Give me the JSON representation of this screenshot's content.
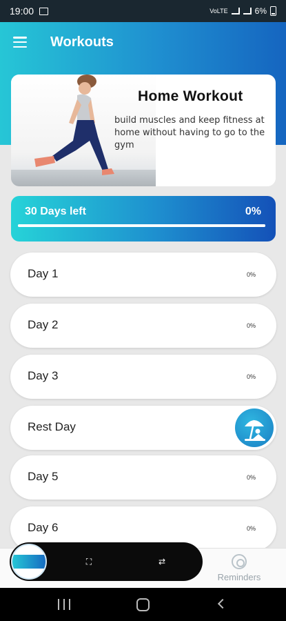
{
  "status_bar": {
    "time": "19:00",
    "battery": "6%",
    "network": "VoLTE"
  },
  "app_bar": {
    "title": "Workouts",
    "menu_icon": "hamburger-menu-icon"
  },
  "hero": {
    "title": "Home Workout",
    "description": "build muscles and keep fitness at home without having to go to the gym"
  },
  "progress": {
    "label": "30 Days left",
    "percent_label": "0%",
    "fraction": 0.0
  },
  "days": [
    {
      "label": "Day 1",
      "percent": "0%"
    },
    {
      "label": "Day 2",
      "percent": "0%"
    },
    {
      "label": "Day 3",
      "percent": "0%"
    },
    {
      "label": "Rest Day",
      "icon": "beach-umbrella-icon"
    },
    {
      "label": "Day 5",
      "percent": "0%"
    },
    {
      "label": "Day 6",
      "percent": "0%"
    }
  ],
  "bottom_nav": {
    "reminders_label": "Reminders"
  },
  "colors": {
    "accent_start": "#26c6d6",
    "accent_end": "#1565c0"
  }
}
